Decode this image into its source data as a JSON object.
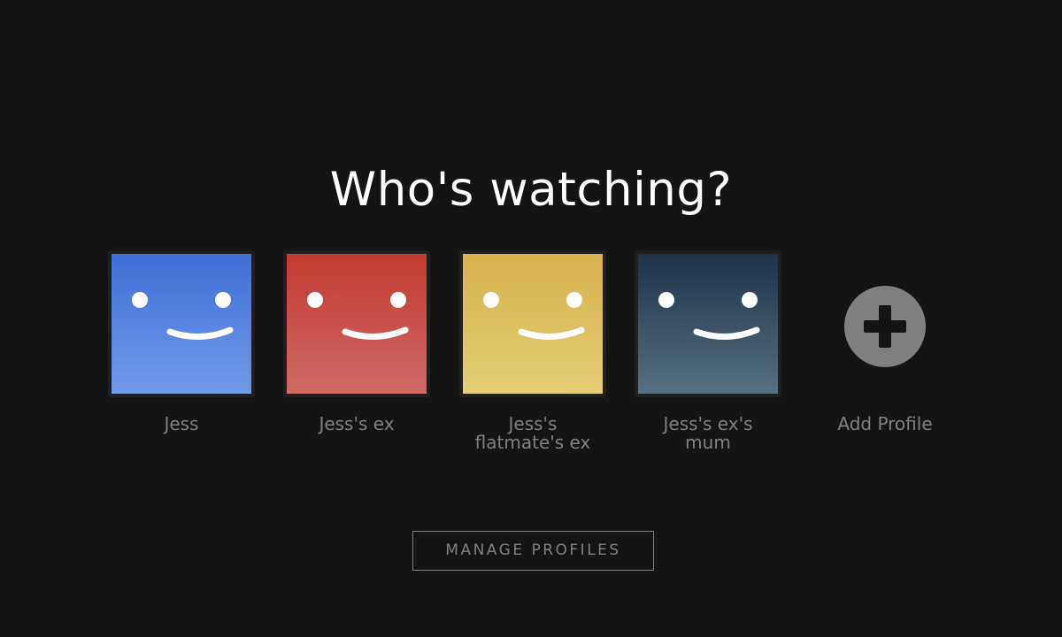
{
  "page": {
    "title": "Who's watching?"
  },
  "profiles": [
    {
      "name": "Jess",
      "color_top": "#3f6fd8",
      "color_bottom": "#6f9ae6"
    },
    {
      "name": "Jess's ex",
      "color_top": "#c33a2f",
      "color_bottom": "#cf6a66"
    },
    {
      "name": "Jess's flatmate's ex",
      "color_top": "#d8b24e",
      "color_bottom": "#e3cd76"
    },
    {
      "name": "Jess's ex's mum",
      "color_top": "#1e3346",
      "color_bottom": "#587080"
    }
  ],
  "add_profile": {
    "label": "Add Profile",
    "icon": "plus-circle-icon"
  },
  "manage": {
    "label": "MANAGE PROFILES"
  },
  "colors": {
    "background": "#141414",
    "text_muted": "#808080",
    "title": "#ffffff",
    "add_circle": "#808080"
  }
}
